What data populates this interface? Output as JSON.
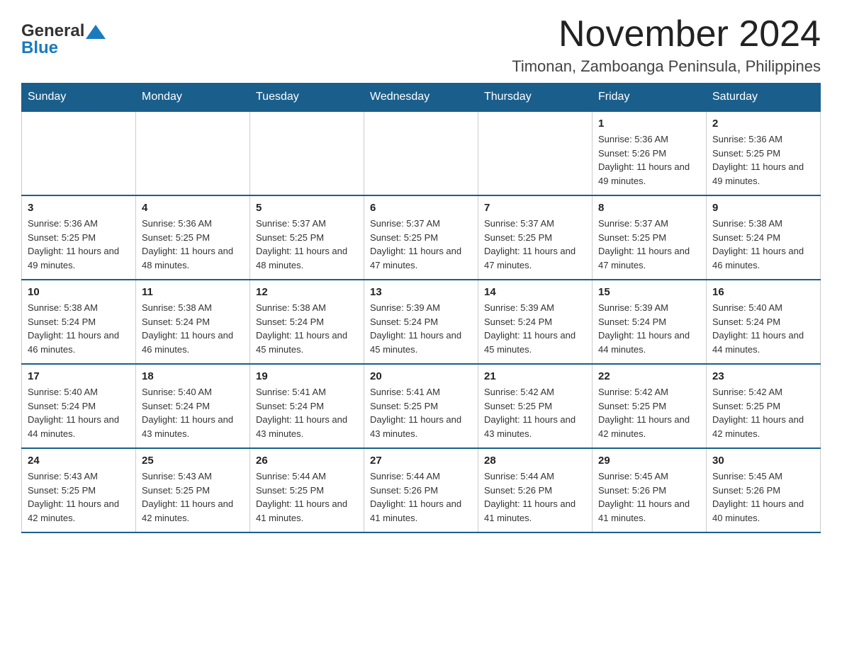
{
  "header": {
    "logo_general": "General",
    "logo_blue": "Blue",
    "month_title": "November 2024",
    "location": "Timonan, Zamboanga Peninsula, Philippines"
  },
  "weekdays": [
    "Sunday",
    "Monday",
    "Tuesday",
    "Wednesday",
    "Thursday",
    "Friday",
    "Saturday"
  ],
  "weeks": [
    [
      {
        "day": "",
        "info": ""
      },
      {
        "day": "",
        "info": ""
      },
      {
        "day": "",
        "info": ""
      },
      {
        "day": "",
        "info": ""
      },
      {
        "day": "",
        "info": ""
      },
      {
        "day": "1",
        "info": "Sunrise: 5:36 AM\nSunset: 5:26 PM\nDaylight: 11 hours and 49 minutes."
      },
      {
        "day": "2",
        "info": "Sunrise: 5:36 AM\nSunset: 5:25 PM\nDaylight: 11 hours and 49 minutes."
      }
    ],
    [
      {
        "day": "3",
        "info": "Sunrise: 5:36 AM\nSunset: 5:25 PM\nDaylight: 11 hours and 49 minutes."
      },
      {
        "day": "4",
        "info": "Sunrise: 5:36 AM\nSunset: 5:25 PM\nDaylight: 11 hours and 48 minutes."
      },
      {
        "day": "5",
        "info": "Sunrise: 5:37 AM\nSunset: 5:25 PM\nDaylight: 11 hours and 48 minutes."
      },
      {
        "day": "6",
        "info": "Sunrise: 5:37 AM\nSunset: 5:25 PM\nDaylight: 11 hours and 47 minutes."
      },
      {
        "day": "7",
        "info": "Sunrise: 5:37 AM\nSunset: 5:25 PM\nDaylight: 11 hours and 47 minutes."
      },
      {
        "day": "8",
        "info": "Sunrise: 5:37 AM\nSunset: 5:25 PM\nDaylight: 11 hours and 47 minutes."
      },
      {
        "day": "9",
        "info": "Sunrise: 5:38 AM\nSunset: 5:24 PM\nDaylight: 11 hours and 46 minutes."
      }
    ],
    [
      {
        "day": "10",
        "info": "Sunrise: 5:38 AM\nSunset: 5:24 PM\nDaylight: 11 hours and 46 minutes."
      },
      {
        "day": "11",
        "info": "Sunrise: 5:38 AM\nSunset: 5:24 PM\nDaylight: 11 hours and 46 minutes."
      },
      {
        "day": "12",
        "info": "Sunrise: 5:38 AM\nSunset: 5:24 PM\nDaylight: 11 hours and 45 minutes."
      },
      {
        "day": "13",
        "info": "Sunrise: 5:39 AM\nSunset: 5:24 PM\nDaylight: 11 hours and 45 minutes."
      },
      {
        "day": "14",
        "info": "Sunrise: 5:39 AM\nSunset: 5:24 PM\nDaylight: 11 hours and 45 minutes."
      },
      {
        "day": "15",
        "info": "Sunrise: 5:39 AM\nSunset: 5:24 PM\nDaylight: 11 hours and 44 minutes."
      },
      {
        "day": "16",
        "info": "Sunrise: 5:40 AM\nSunset: 5:24 PM\nDaylight: 11 hours and 44 minutes."
      }
    ],
    [
      {
        "day": "17",
        "info": "Sunrise: 5:40 AM\nSunset: 5:24 PM\nDaylight: 11 hours and 44 minutes."
      },
      {
        "day": "18",
        "info": "Sunrise: 5:40 AM\nSunset: 5:24 PM\nDaylight: 11 hours and 43 minutes."
      },
      {
        "day": "19",
        "info": "Sunrise: 5:41 AM\nSunset: 5:24 PM\nDaylight: 11 hours and 43 minutes."
      },
      {
        "day": "20",
        "info": "Sunrise: 5:41 AM\nSunset: 5:25 PM\nDaylight: 11 hours and 43 minutes."
      },
      {
        "day": "21",
        "info": "Sunrise: 5:42 AM\nSunset: 5:25 PM\nDaylight: 11 hours and 43 minutes."
      },
      {
        "day": "22",
        "info": "Sunrise: 5:42 AM\nSunset: 5:25 PM\nDaylight: 11 hours and 42 minutes."
      },
      {
        "day": "23",
        "info": "Sunrise: 5:42 AM\nSunset: 5:25 PM\nDaylight: 11 hours and 42 minutes."
      }
    ],
    [
      {
        "day": "24",
        "info": "Sunrise: 5:43 AM\nSunset: 5:25 PM\nDaylight: 11 hours and 42 minutes."
      },
      {
        "day": "25",
        "info": "Sunrise: 5:43 AM\nSunset: 5:25 PM\nDaylight: 11 hours and 42 minutes."
      },
      {
        "day": "26",
        "info": "Sunrise: 5:44 AM\nSunset: 5:25 PM\nDaylight: 11 hours and 41 minutes."
      },
      {
        "day": "27",
        "info": "Sunrise: 5:44 AM\nSunset: 5:26 PM\nDaylight: 11 hours and 41 minutes."
      },
      {
        "day": "28",
        "info": "Sunrise: 5:44 AM\nSunset: 5:26 PM\nDaylight: 11 hours and 41 minutes."
      },
      {
        "day": "29",
        "info": "Sunrise: 5:45 AM\nSunset: 5:26 PM\nDaylight: 11 hours and 41 minutes."
      },
      {
        "day": "30",
        "info": "Sunrise: 5:45 AM\nSunset: 5:26 PM\nDaylight: 11 hours and 40 minutes."
      }
    ]
  ]
}
